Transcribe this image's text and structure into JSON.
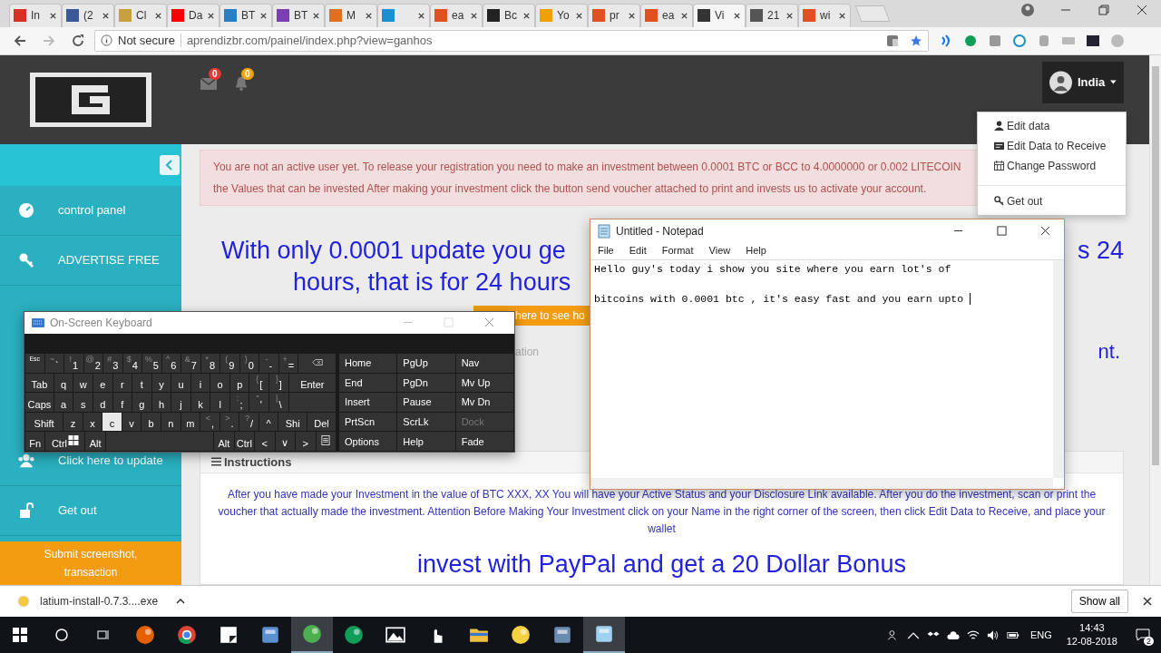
{
  "browser": {
    "tabs": [
      {
        "title": "In",
        "color": "#d93025",
        "selected": false
      },
      {
        "title": "(2",
        "color": "#3b5998",
        "selected": false
      },
      {
        "title": "Cl",
        "color": "#c8a040",
        "selected": false
      },
      {
        "title": "Da",
        "color": "#ff0000",
        "selected": false
      },
      {
        "title": "BT",
        "color": "#2a7fc0",
        "selected": false
      },
      {
        "title": "BT",
        "color": "#7a3fb0",
        "selected": false
      },
      {
        "title": "M",
        "color": "#e07020",
        "selected": false
      },
      {
        "color": "#1a90d0",
        "selected": false
      },
      {
        "title": "ea",
        "color": "#e05020",
        "selected": false
      },
      {
        "title": "Bc",
        "color": "#222222",
        "selected": false
      },
      {
        "title": "Yo",
        "color": "#f0a000",
        "selected": false
      },
      {
        "title": "pr",
        "color": "#e05020",
        "selected": false
      },
      {
        "title": "ea",
        "color": "#e05020",
        "selected": false
      },
      {
        "title": "Vi",
        "color": "#333333",
        "selected": true
      },
      {
        "title": "21",
        "color": "#555555",
        "selected": false
      },
      {
        "title": "wi",
        "color": "#e05020",
        "selected": false
      }
    ],
    "address": {
      "security": "Not secure",
      "url": "aprendizbr.com/painel/index.php?view=ganhos"
    }
  },
  "header": {
    "mail_count": "0",
    "notification_count": "0",
    "user": {
      "name": "India",
      "expanded": true
    },
    "menu": [
      {
        "label": "Edit data",
        "kind": "user",
        "separated": false
      },
      {
        "label": "Edit Data to Receive",
        "kind": "card",
        "separated": false
      },
      {
        "label": "Change Password",
        "kind": "calendar",
        "separated": false
      },
      {
        "label": "Get out",
        "kind": "key",
        "separated": true
      }
    ]
  },
  "sidebar": {
    "upper_items": [
      {
        "label": "control panel",
        "kind": "dashboard"
      },
      {
        "label": "ADVERTISE FREE",
        "kind": "key"
      }
    ],
    "lower_items": [
      {
        "label": "Click here to update",
        "kind": "users"
      },
      {
        "label": "Get out",
        "kind": "unlock"
      }
    ],
    "submit": "Submit screenshot, transaction"
  },
  "alert": {
    "lines": [
      "You are not an active user yet. To release your registration you need to make an investment between 0.0001 BTC or BCC to 4.0000000 or 0.002 LITECOIN",
      "the Values that can be invested After making your investment click the button send voucher attached to print and invests us to activate your account."
    ]
  },
  "headline": {
    "left_fragment": "With only 0.0001 update you ge",
    "right_fragment": "s 24",
    "second_line": "hours, that is for 24 hours"
  },
  "orange_button": "here to see ho",
  "faint_fragment": "ation",
  "blue_fragment": "nt.",
  "instructions": {
    "title": "Instructions",
    "text": "After you have made your Investment in the value of BTC XXX, XX You will have your Active Status and your Disclosure Link available. After you do the investment, scan or print the voucher that actually made the investment. Attention Before Making Your Investment click on your Name in the right corner of the screen, then click Edit Data to Receive, and place your wallet"
  },
  "paypal": "invest with PayPal and get a 20 Dollar Bonus",
  "notepad": {
    "title": "Untitled - Notepad",
    "menu": [
      "File",
      "Edit",
      "Format",
      "View",
      "Help"
    ],
    "text": "Hello guy's today i show you site where you earn lot's of\n\nbitcoins with 0.0001 btc , it's easy fast and you earn upto "
  },
  "keyboard": {
    "title": "On-Screen Keyboard",
    "main_rows": [
      [
        {
          "label": "Esc",
          "kind": "small",
          "pressed": false
        },
        {
          "label": "`",
          "shift": "~",
          "kind": "key",
          "pressed": false
        },
        {
          "label": "1",
          "shift": "!",
          "kind": "key",
          "pressed": false
        },
        {
          "label": "2",
          "shift": "@",
          "kind": "key",
          "pressed": false
        },
        {
          "label": "3",
          "shift": "#",
          "kind": "key",
          "pressed": false
        },
        {
          "label": "4",
          "shift": "$",
          "kind": "key",
          "pressed": false
        },
        {
          "label": "5",
          "shift": "%",
          "kind": "key",
          "pressed": false
        },
        {
          "label": "6",
          "shift": "^",
          "kind": "key",
          "pressed": false
        },
        {
          "label": "7",
          "shift": "&",
          "kind": "key",
          "pressed": false
        },
        {
          "label": "8",
          "shift": "*",
          "kind": "key",
          "pressed": false
        },
        {
          "label": "9",
          "shift": "(",
          "kind": "key",
          "pressed": false
        },
        {
          "label": "0",
          "shift": ")",
          "kind": "key",
          "pressed": false
        },
        {
          "label": "-",
          "shift": "-",
          "kind": "key",
          "pressed": false
        },
        {
          "label": "=",
          "shift": "+",
          "kind": "key",
          "pressed": false
        },
        {
          "kind": "backspace",
          "pressed": false
        }
      ],
      [
        {
          "label": "Tab",
          "kind": "tab",
          "pressed": false
        },
        {
          "label": "q",
          "kind": "key",
          "pressed": false
        },
        {
          "label": "w",
          "kind": "key",
          "pressed": false
        },
        {
          "label": "e",
          "kind": "key",
          "pressed": false
        },
        {
          "label": "r",
          "kind": "key",
          "pressed": false
        },
        {
          "label": "t",
          "kind": "key",
          "pressed": false
        },
        {
          "label": "y",
          "kind": "key",
          "pressed": false
        },
        {
          "label": "u",
          "kind": "key",
          "pressed": false
        },
        {
          "label": "i",
          "kind": "key",
          "pressed": false
        },
        {
          "label": "o",
          "kind": "key",
          "pressed": false
        },
        {
          "label": "p",
          "kind": "key",
          "pressed": false
        },
        {
          "label": "[",
          "shift": "{",
          "kind": "key",
          "pressed": false
        },
        {
          "label": "]",
          "shift": "}",
          "kind": "key",
          "pressed": false
        },
        {
          "label": "Enter",
          "kind": "enter",
          "pressed": false
        }
      ],
      [
        {
          "label": "Caps",
          "kind": "tab",
          "pressed": false
        },
        {
          "label": "a",
          "kind": "key",
          "pressed": false
        },
        {
          "label": "s",
          "kind": "key",
          "pressed": false
        },
        {
          "label": "d",
          "kind": "key",
          "pressed": false
        },
        {
          "label": "f",
          "kind": "key",
          "pressed": false
        },
        {
          "label": "g",
          "kind": "key",
          "pressed": false
        },
        {
          "label": "h",
          "kind": "key",
          "pressed": false
        },
        {
          "label": "j",
          "kind": "key",
          "pressed": false
        },
        {
          "label": "k",
          "kind": "key",
          "pressed": false
        },
        {
          "label": "l",
          "kind": "key",
          "pressed": false
        },
        {
          "label": ";",
          "shift": ":",
          "kind": "key",
          "pressed": false
        },
        {
          "label": "'",
          "shift": "\"",
          "kind": "key",
          "pressed": false
        },
        {
          "label": "\\",
          "shift": "|",
          "kind": "key",
          "pressed": false
        },
        {
          "kind": "blank",
          "pressed": false
        }
      ],
      [
        {
          "label": "Shift",
          "kind": "shift",
          "pressed": false
        },
        {
          "label": "z",
          "kind": "key",
          "pressed": false
        },
        {
          "label": "x",
          "kind": "key",
          "pressed": false
        },
        {
          "label": "c",
          "kind": "key",
          "pressed": true
        },
        {
          "label": "v",
          "kind": "key",
          "pressed": false
        },
        {
          "label": "b",
          "kind": "key",
          "pressed": false
        },
        {
          "label": "n",
          "kind": "key",
          "pressed": false
        },
        {
          "label": "m",
          "kind": "key",
          "pressed": false
        },
        {
          "label": ",",
          "shift": "<",
          "kind": "key",
          "pressed": false
        },
        {
          "label": ".",
          "shift": ">",
          "kind": "key",
          "pressed": false
        },
        {
          "label": "/",
          "shift": "?",
          "kind": "key",
          "pressed": false
        },
        {
          "label": "^",
          "kind": "key",
          "pressed": false
        },
        {
          "label": "Shi",
          "kind": "mod",
          "pressed": false
        },
        {
          "label": "Del",
          "kind": "mod",
          "pressed": false
        }
      ],
      [
        {
          "label": "Fn",
          "kind": "key",
          "pressed": false
        },
        {
          "label": "Ctrl",
          "kind": "winctrl",
          "pressed": false
        },
        {
          "label": "Alt",
          "kind": "key",
          "pressed": false
        },
        {
          "kind": "space",
          "pressed": false
        },
        {
          "label": "Alt",
          "kind": "key",
          "pressed": false
        },
        {
          "label": "Ctrl",
          "kind": "key",
          "pressed": false
        },
        {
          "label": "<",
          "kind": "key",
          "pressed": false
        },
        {
          "label": "∨",
          "kind": "key",
          "pressed": false
        },
        {
          "label": ">",
          "kind": "key",
          "pressed": false
        },
        {
          "kind": "menu",
          "pressed": false
        }
      ]
    ],
    "nav_rows": [
      [
        {
          "label": "Home",
          "disabled": false
        },
        {
          "label": "PgUp",
          "disabled": false
        },
        {
          "label": "Nav",
          "disabled": false
        }
      ],
      [
        {
          "label": "End",
          "disabled": false
        },
        {
          "label": "PgDn",
          "disabled": false
        },
        {
          "label": "Mv Up",
          "disabled": false
        }
      ],
      [
        {
          "label": "Insert",
          "disabled": false
        },
        {
          "label": "Pause",
          "disabled": false
        },
        {
          "label": "Mv Dn",
          "disabled": false
        }
      ],
      [
        {
          "label": "PrtScn",
          "disabled": false
        },
        {
          "label": "ScrLk",
          "disabled": false
        },
        {
          "label": "Dock",
          "disabled": true
        }
      ],
      [
        {
          "label": "Options",
          "disabled": false
        },
        {
          "label": "Help",
          "disabled": false
        },
        {
          "label": "Fade",
          "disabled": false
        }
      ]
    ]
  },
  "download": {
    "file": "latium-install-0.7.3....exe",
    "show_all": "Show all"
  },
  "taskbar": {
    "apps": [
      {
        "kind": "fox",
        "active": false
      },
      {
        "kind": "chrome",
        "active": false
      },
      {
        "kind": "sticky",
        "active": false
      },
      {
        "kind": "remote",
        "active": false
      },
      {
        "kind": "globe",
        "active": true
      },
      {
        "kind": "chat",
        "active": false
      },
      {
        "kind": "photos",
        "active": false
      },
      {
        "kind": "hand",
        "active": false
      },
      {
        "kind": "folder",
        "active": false
      },
      {
        "kind": "ball",
        "active": false
      },
      {
        "kind": "disk",
        "active": false
      },
      {
        "kind": "notepad",
        "active": true
      }
    ],
    "language": "ENG",
    "time": "14:43",
    "date": "12-08-2018",
    "notifications": "2"
  }
}
